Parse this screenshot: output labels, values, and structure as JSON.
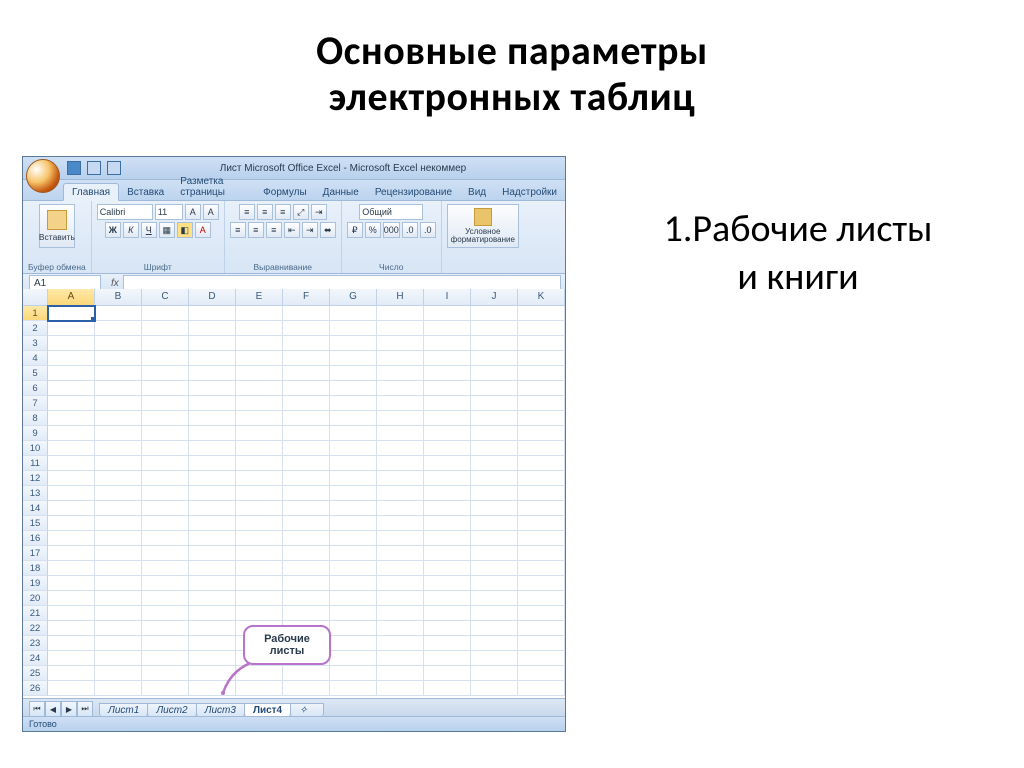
{
  "slide": {
    "title_line1": "Основные параметры",
    "title_line2": "электронных таблиц",
    "bullet1_line1": "1.Рабочие листы",
    "bullet1_line2": "и книги"
  },
  "excel": {
    "window_title": "Лист Microsoft Office Excel - Microsoft Excel некоммер",
    "tabs": {
      "home": "Главная",
      "insert": "Вставка",
      "layout": "Разметка страницы",
      "formulas": "Формулы",
      "data": "Данные",
      "review": "Рецензирование",
      "view": "Вид",
      "addins": "Надстройки"
    },
    "ribbon": {
      "paste": "Вставить",
      "clipboard": "Буфер обмена",
      "font_name": "Calibri",
      "font_size": "11",
      "font_group": "Шрифт",
      "align_group": "Выравнивание",
      "num_format": "Общий",
      "number_group": "Число",
      "cond_fmt_line1": "Условное",
      "cond_fmt_line2": "форматирование"
    },
    "namebox": "A1",
    "columns": [
      "A",
      "B",
      "C",
      "D",
      "E",
      "F",
      "G",
      "H",
      "I",
      "J",
      "K"
    ],
    "rows": [
      "1",
      "2",
      "3",
      "4",
      "5",
      "6",
      "7",
      "8",
      "9",
      "10",
      "11",
      "12",
      "13",
      "14",
      "15",
      "16",
      "17",
      "18",
      "19",
      "20",
      "21",
      "22",
      "23",
      "24",
      "25",
      "26"
    ],
    "sheets": {
      "s1": "Лист1",
      "s2": "Лист2",
      "s3": "Лист3",
      "s4": "Лист4"
    },
    "status": "Готово",
    "callout_line1": "Рабочие",
    "callout_line2": "листы"
  }
}
